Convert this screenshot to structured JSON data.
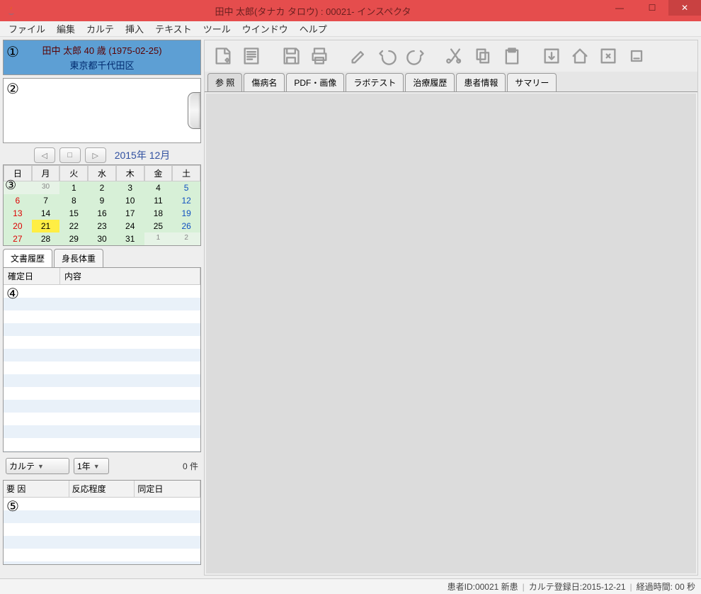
{
  "title": "田中 太郎(タナカ タロウ) : 00021- インスペクタ",
  "menu": {
    "items": [
      "ファイル",
      "編集",
      "カルテ",
      "挿入",
      "テキスト",
      "ツール",
      "ウインドウ",
      "ヘルプ"
    ]
  },
  "patient": {
    "line1": "田中 太郎 40 歳 (1975-02-25)",
    "line2": "東京都千代田区"
  },
  "circ": {
    "one": "①",
    "two": "②",
    "three": "③",
    "four": "④",
    "five": "⑤"
  },
  "calnav": {
    "title": "2015年 12月"
  },
  "weekdays": [
    "日",
    "月",
    "火",
    "水",
    "木",
    "金",
    "土"
  ],
  "calendar": [
    [
      {
        "d": "",
        "c": "prev"
      },
      {
        "d": "30",
        "c": "prev"
      },
      {
        "d": "1",
        "c": ""
      },
      {
        "d": "2",
        "c": ""
      },
      {
        "d": "3",
        "c": ""
      },
      {
        "d": "4",
        "c": ""
      },
      {
        "d": "5",
        "c": "sat"
      }
    ],
    [
      {
        "d": "6",
        "c": "sun"
      },
      {
        "d": "7",
        "c": ""
      },
      {
        "d": "8",
        "c": ""
      },
      {
        "d": "9",
        "c": ""
      },
      {
        "d": "10",
        "c": ""
      },
      {
        "d": "11",
        "c": ""
      },
      {
        "d": "12",
        "c": "sat"
      }
    ],
    [
      {
        "d": "13",
        "c": "sun"
      },
      {
        "d": "14",
        "c": ""
      },
      {
        "d": "15",
        "c": ""
      },
      {
        "d": "16",
        "c": ""
      },
      {
        "d": "17",
        "c": ""
      },
      {
        "d": "18",
        "c": ""
      },
      {
        "d": "19",
        "c": "sat"
      }
    ],
    [
      {
        "d": "20",
        "c": "sun"
      },
      {
        "d": "21",
        "c": "today"
      },
      {
        "d": "22",
        "c": ""
      },
      {
        "d": "23",
        "c": ""
      },
      {
        "d": "24",
        "c": ""
      },
      {
        "d": "25",
        "c": ""
      },
      {
        "d": "26",
        "c": "sat"
      }
    ],
    [
      {
        "d": "27",
        "c": "sun"
      },
      {
        "d": "28",
        "c": ""
      },
      {
        "d": "29",
        "c": ""
      },
      {
        "d": "30",
        "c": ""
      },
      {
        "d": "31",
        "c": ""
      },
      {
        "d": "1",
        "c": "next"
      },
      {
        "d": "2",
        "c": "next sat"
      }
    ]
  ],
  "subtabs": {
    "a": "文書履歴",
    "b": "身長体重"
  },
  "docs_head": {
    "a": "確定日",
    "b": "内容"
  },
  "filters": {
    "type": "カルテ",
    "period": "1年",
    "count": "0 件"
  },
  "allergy_head": {
    "a": "要 因",
    "b": "反応程度",
    "c": "同定日"
  },
  "maintabs": [
    "参 照",
    "傷病名",
    "PDF・画像",
    "ラボテスト",
    "治療履歴",
    "患者情報",
    "サマリー"
  ],
  "status": {
    "a": "患者ID:00021 新患",
    "b": "カルテ登録日:2015-12-21",
    "c": "経過時間: 00 秒"
  },
  "toolbar_icons": [
    "new-doc",
    "text-doc",
    "save",
    "print",
    "edit",
    "undo",
    "redo",
    "cut",
    "copy",
    "paste",
    "export",
    "home",
    "attach",
    "stamp"
  ]
}
